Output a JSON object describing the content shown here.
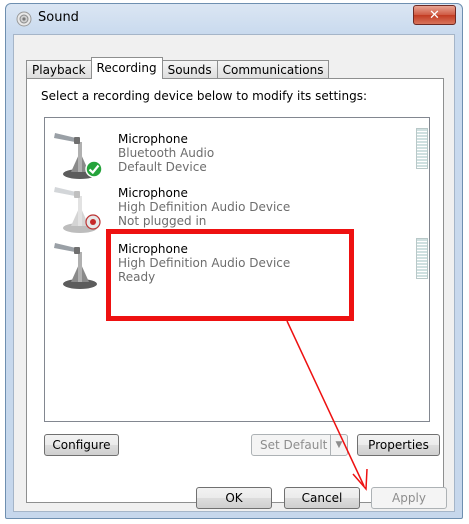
{
  "window": {
    "title": "Sound",
    "close_label": "✕"
  },
  "tabs": [
    {
      "label": "Playback",
      "active": false
    },
    {
      "label": "Recording",
      "active": true
    },
    {
      "label": "Sounds",
      "active": false
    },
    {
      "label": "Communications",
      "active": false
    }
  ],
  "instruction": "Select a recording device below to modify its settings:",
  "devices": [
    {
      "name": "Microphone",
      "line1": "Bluetooth Audio",
      "line2": "Default Device",
      "badge": "check-icon",
      "has_meter": true
    },
    {
      "name": "Microphone",
      "line1": "High Definition Audio Device",
      "line2": "Not plugged in",
      "badge": "unplugged-icon",
      "has_meter": false
    },
    {
      "name": "Microphone",
      "line1": "High Definition Audio Device",
      "line2": "Ready",
      "badge": "none",
      "has_meter": true
    }
  ],
  "buttons": {
    "configure": "Configure",
    "set_default": "Set Default",
    "properties": "Properties",
    "ok": "OK",
    "cancel": "Cancel",
    "apply": "Apply"
  },
  "annotation": {
    "color": "#ee1111"
  }
}
